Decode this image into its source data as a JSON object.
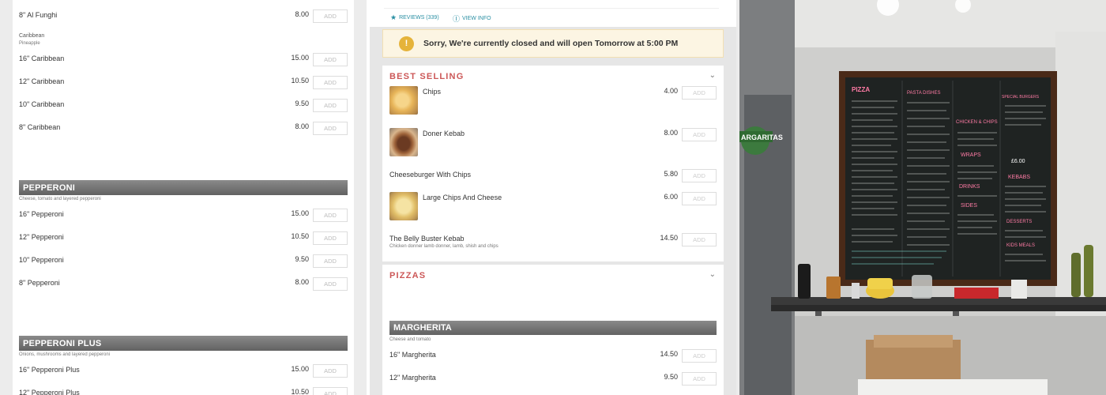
{
  "left_menu": {
    "add_label": "ADD",
    "top_items": [
      {
        "name": "8\" Al Funghi",
        "price": "8.00"
      }
    ],
    "caribbean": {
      "title": "Caribbean",
      "subtitle": "Pineapple",
      "items": [
        {
          "name": "16\" Caribbean",
          "price": "15.00"
        },
        {
          "name": "12\" Caribbean",
          "price": "10.50"
        },
        {
          "name": "10\" Caribbean",
          "price": "9.50"
        },
        {
          "name": "8\" Caribbean",
          "price": "8.00"
        }
      ]
    },
    "pepperoni": {
      "title": "PEPPERONI",
      "description": "Cheese, tomato and layered pepperoni",
      "items": [
        {
          "name": "16\" Pepperoni",
          "price": "15.00"
        },
        {
          "name": "12\" Pepperoni",
          "price": "10.50"
        },
        {
          "name": "10\" Pepperoni",
          "price": "9.50"
        },
        {
          "name": "8\" Pepperoni",
          "price": "8.00"
        }
      ]
    },
    "pepperoni_plus": {
      "title": "PEPPERONI PLUS",
      "description": "Onions, mushrooms and layered pepperoni",
      "items": [
        {
          "name": "16\" Pepperoni Plus",
          "price": "15.00"
        },
        {
          "name": "12\" Pepperoni Plus",
          "price": "10.50"
        }
      ]
    }
  },
  "restaurant": {
    "reviews_link": "REVIEWS (339)",
    "view_info_link": "VIEW INFO",
    "notice": "Sorry, We're currently closed and will open Tomorrow at 5:00 PM",
    "notice_icon": "!"
  },
  "best_selling": {
    "title": "BEST SELLING",
    "add_label": "ADD",
    "items": [
      {
        "name": "Chips",
        "price": "4.00",
        "image": "chips"
      },
      {
        "name": "Doner Kebab",
        "price": "8.00",
        "image": "kebab"
      },
      {
        "name": "Cheeseburger With Chips",
        "price": "5.80"
      },
      {
        "name": "Large Chips And Cheese",
        "price": "6.00",
        "image": "large-chips"
      },
      {
        "name": "The Belly Buster Kebab",
        "description": "Chicken donner lamb donner, lamb, shish and chips",
        "price": "14.50"
      }
    ]
  },
  "pizzas": {
    "title": "PIZZAS",
    "add_label": "ADD",
    "margherita": {
      "title": "MARGHERITA",
      "description": "Cheese and tomato",
      "items": [
        {
          "name": "16\" Margherita",
          "price": "14.50"
        },
        {
          "name": "12\" Margherita",
          "price": "9.50"
        }
      ]
    }
  },
  "photo": {
    "sign_text": "ARGARITAS",
    "board_headings": [
      "PIZZA",
      "PASTA DISHES",
      "SPECIAL BURGERS",
      "CHICKEN & CHIPS",
      "WRAPS",
      "DRINKS",
      "SIDES",
      "KEBABS",
      "DESSERTS",
      "KIDS MEALS"
    ],
    "board_price": "£6.00"
  },
  "colors": {
    "accent_red": "#cc5757",
    "link_teal": "#2a8fa3",
    "notice_bg": "#fcf5e3",
    "notice_icon": "#e5b33a",
    "category_bar": "#6e6e6e"
  }
}
